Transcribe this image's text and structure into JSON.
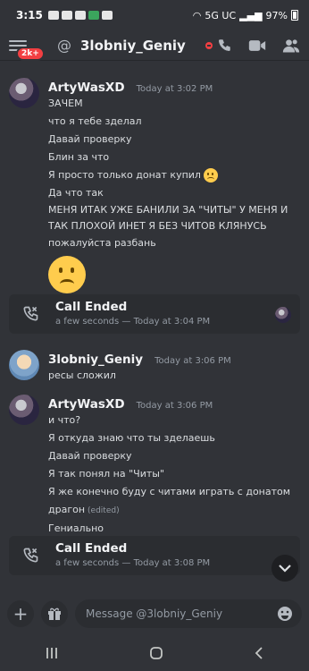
{
  "status": {
    "time": "3:15",
    "network": "5G UC",
    "battery": "97%"
  },
  "header": {
    "badge": "2k+",
    "channel_prefix": "@",
    "channel_name": "3lobniy_Geniy"
  },
  "messages": [
    {
      "author": "ArtyWasXD",
      "timestamp": "Today at 3:02 PM",
      "lines": [
        "ЗАЧЕМ",
        "что я тебе зделал",
        "Давай проверку",
        "Блин  за что",
        "Я просто только  донат купил",
        "Да что так",
        "МЕНЯ ИТАК УЖЕ БАНИЛИ ЗА \"ЧИТЫ\" У МЕНЯ И ТАК ПЛОХОЙ ИНЕТ Я БЕЗ ЧИТОВ КЛЯНУСЬ",
        "пожалуйста  разбань"
      ]
    },
    {
      "author": "3lobniy_Geniy",
      "timestamp": "Today at 3:06 PM",
      "lines": [
        "ресы сложил"
      ]
    },
    {
      "author": "ArtyWasXD",
      "timestamp": "Today at 3:06 PM",
      "lines": [
        "и что?",
        "Я откуда знаю что ты зделаешь",
        "Давай проверку",
        "Я так понял на \"Читы\"",
        "Я же конечно  буду с читами играть с донатом",
        "драгон",
        "Гениально"
      ],
      "edited_label": "(edited)"
    }
  ],
  "calls": [
    {
      "title": "Call Ended",
      "subtitle": "a few seconds — Today at 3:04 PM"
    },
    {
      "title": "Call Ended",
      "subtitle": "a few seconds — Today at 3:08 PM"
    }
  ],
  "composer": {
    "placeholder": "Message @3lobniy_Geniy"
  }
}
